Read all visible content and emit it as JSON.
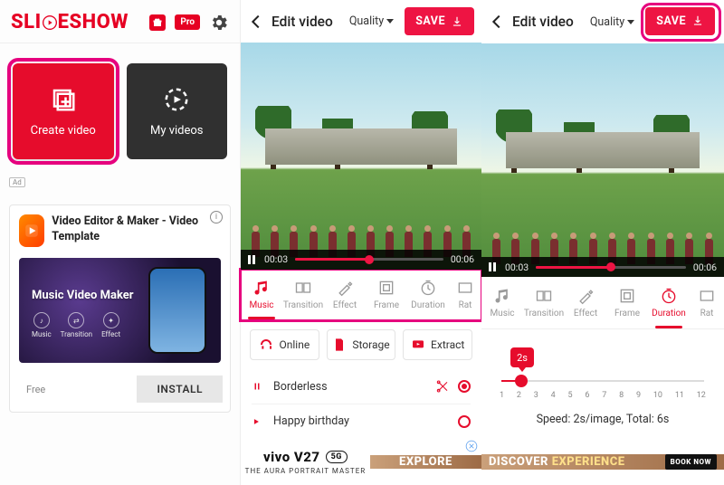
{
  "brand": {
    "part1": "SLI",
    "part2": "ESHOW",
    "pro": "Pro"
  },
  "tiles": {
    "create": "Create video",
    "myvideos": "My videos"
  },
  "ad1": {
    "tag": "Ad",
    "title": "Video Editor & Maker - Video Template",
    "creative_title": "Music Video Maker",
    "chips": [
      "Music",
      "Transition",
      "Effect"
    ],
    "free": "Free",
    "install": "INSTALL"
  },
  "editor": {
    "title": "Edit video",
    "quality": "Quality",
    "save": "SAVE",
    "time_cur": "00:03",
    "time_tot": "00:06",
    "tabs": {
      "music": "Music",
      "transition": "Transition",
      "effect": "Effect",
      "frame": "Frame",
      "duration": "Duration",
      "ratio": "Rat"
    }
  },
  "music": {
    "sources": {
      "online": "Online",
      "storage": "Storage",
      "extract": "Extract"
    },
    "tracks": [
      {
        "name": "Borderless",
        "playing": true,
        "selected": true
      },
      {
        "name": "Happy birthday",
        "playing": false,
        "selected": false
      }
    ]
  },
  "duration": {
    "value_label": "2s",
    "ticks": [
      "1",
      "2",
      "3",
      "4",
      "5",
      "6",
      "7",
      "8",
      "9",
      "10",
      "11",
      "12"
    ],
    "summary": "Speed: 2s/image, Total: 6s"
  },
  "strip": {
    "vivo_model": "vivo V27",
    "vivo_5g": "5G",
    "vivo_sub": "THE AURA PORTRAIT MASTER",
    "promo_words": [
      "EXPLORE",
      "DISCOVER",
      "EXPERIENCE"
    ],
    "book": "BOOK NOW"
  }
}
